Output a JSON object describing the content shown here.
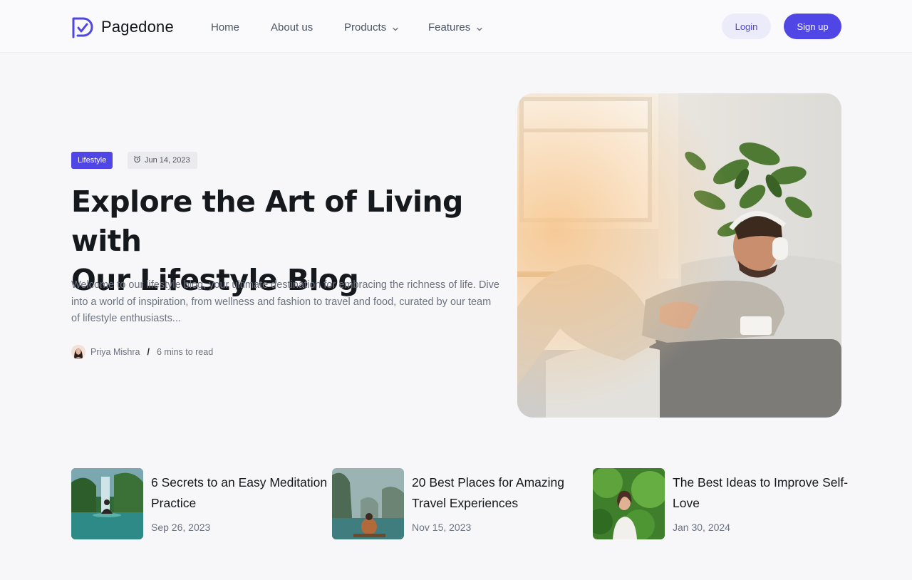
{
  "header": {
    "logo_text": "Pagedone",
    "nav": [
      {
        "label": "Home"
      },
      {
        "label": "About us"
      },
      {
        "label": "Products"
      },
      {
        "label": "Features"
      }
    ],
    "login_label": "Login",
    "signup_label": "Sign up"
  },
  "hero": {
    "tag": "Lifestyle",
    "date": "Jun 14, 2023",
    "title_line1": "Explore the Art of Living with",
    "title_line2": "Our Lifestyle Blog",
    "description": "Welcome to our lifestyle blog, your ultimate destination for embracing the richness of life. Dive into a world of inspiration, from wellness and fashion to travel and food, curated by our team of lifestyle enthusiasts...",
    "author": "Priya Mishra",
    "read_time": "6 mins to read"
  },
  "posts": [
    {
      "title": "6 Secrets to an Easy Meditation Practice",
      "date": "Sep 26, 2023"
    },
    {
      "title": "20 Best Places for Amazing Travel Experiences",
      "date": "Nov 15, 2023"
    },
    {
      "title": "The Best Ideas to Improve Self-Love",
      "date": "Jan 30, 2024"
    }
  ],
  "colors": {
    "accent": "#4f46e5",
    "accent_soft": "#ebebfa",
    "background": "#f7f7f9",
    "text_primary": "#15181d",
    "text_secondary": "#6b7280"
  },
  "icons": {
    "logo": "pagedone-logo-icon",
    "chevron": "chevron-down-icon",
    "date": "alarm-clock-icon"
  }
}
